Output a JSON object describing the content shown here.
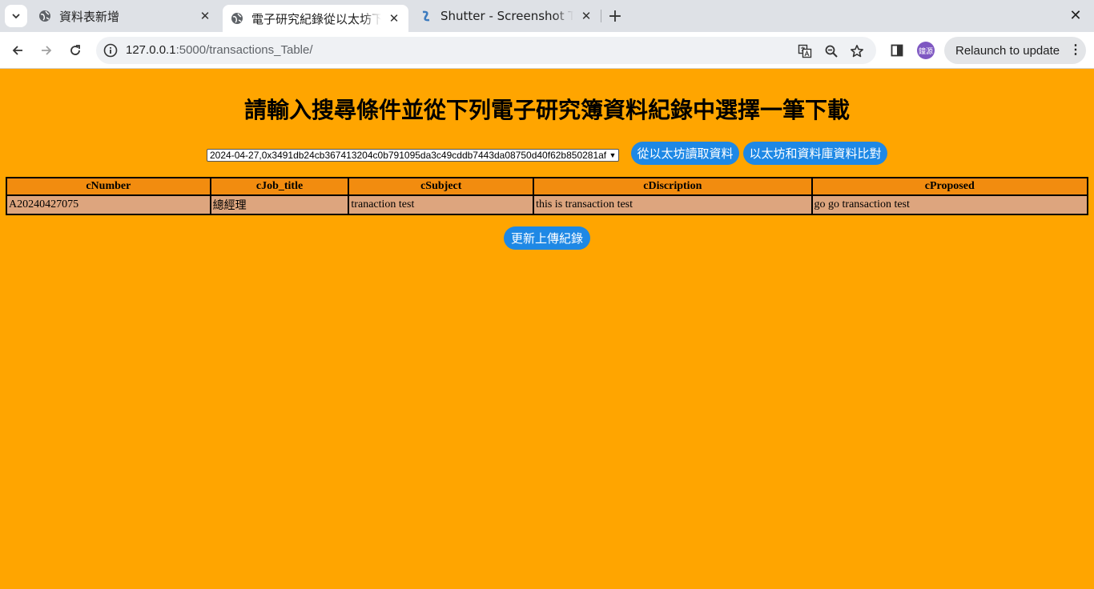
{
  "browser": {
    "tabs": [
      {
        "title": "資料表新增",
        "active": false
      },
      {
        "title": "電子研究紀錄從以太坊下載",
        "active": true
      },
      {
        "title": "Shutter - Screenshot Tool",
        "active": false
      }
    ],
    "url_host": "127.0.0.1",
    "url_path": ":5000/transactions_Table/",
    "avatar_text": "鐘源",
    "relaunch_label": "Relaunch to update"
  },
  "page": {
    "heading": "請輸入搜尋條件並從下列電子研究簿資料紀錄中選擇一筆下載",
    "record_select": "2024-04-27,0x3491db24cb367413204c0b791095da3c49cddb7443da08750d40f62b850281af",
    "read_button": "從以太坊讀取資料",
    "compare_button": "以太坊和資料庫資料比對",
    "update_button": "更新上傳紀錄",
    "table": {
      "headers": [
        "cNumber",
        "cJob_title",
        "cSubject",
        "cDiscription",
        "cProposed"
      ],
      "rows": [
        [
          "A20240427075",
          "總經理",
          "tranaction test",
          "this is transaction test",
          "go go transaction test"
        ]
      ]
    }
  },
  "colors": {
    "page_background": "#FFA500",
    "header_cell": "#F28C0F",
    "body_cell": "#DDA57E",
    "button": "#1E88E5"
  }
}
